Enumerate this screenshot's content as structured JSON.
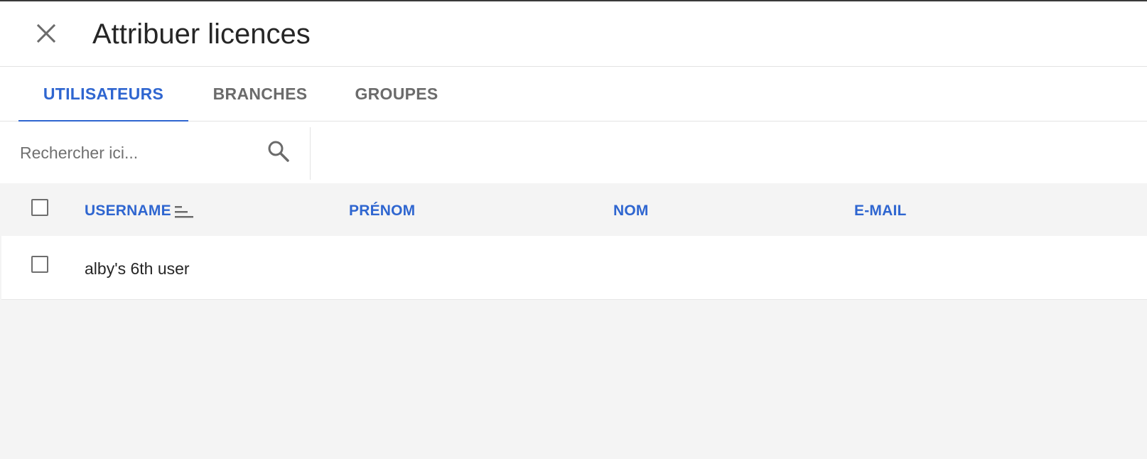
{
  "header": {
    "title": "Attribuer licences",
    "close_icon": "close-icon"
  },
  "tabs": [
    {
      "label": "UTILISATEURS",
      "active": true
    },
    {
      "label": "BRANCHES",
      "active": false
    },
    {
      "label": "GROUPES",
      "active": false
    }
  ],
  "search": {
    "placeholder": "Rechercher ici...",
    "value": "",
    "icon": "search-icon"
  },
  "table": {
    "columns": [
      "USERNAME",
      "PRÉNOM",
      "NOM",
      "E-MAIL"
    ],
    "sorted_column": "USERNAME",
    "sort_icon": "sort-icon",
    "rows": [
      {
        "username": "alby's 6th user",
        "prenom": "",
        "nom": "",
        "email": "",
        "checked": false
      }
    ]
  },
  "colors": {
    "accent": "#2f66d0",
    "tab_inactive": "#6b6b6b",
    "header_bg": "#f4f4f4"
  }
}
